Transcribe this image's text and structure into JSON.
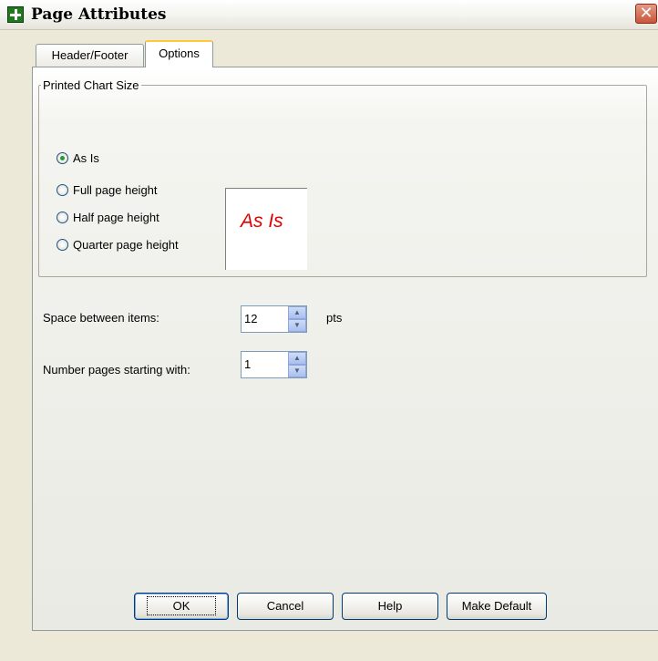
{
  "window": {
    "title": "Page Attributes",
    "close_glyph": "✕"
  },
  "tabs": [
    {
      "label": "Header/Footer",
      "active": false
    },
    {
      "label": "Options",
      "active": true
    }
  ],
  "chart_size": {
    "legend": "Printed Chart Size",
    "options": [
      {
        "label": "As Is",
        "checked": true
      },
      {
        "label": "Full page height",
        "checked": false
      },
      {
        "label": "Half page height",
        "checked": false
      },
      {
        "label": "Quarter page height",
        "checked": false
      }
    ],
    "preview_text": "As Is"
  },
  "space_between": {
    "label": "Space between items:",
    "value": "12",
    "unit": "pts"
  },
  "number_pages": {
    "label": "Number pages starting with:",
    "value": "1"
  },
  "buttons": {
    "ok": "OK",
    "cancel": "Cancel",
    "help": "Help",
    "make_default": "Make Default"
  },
  "colors": {
    "dialog_bg": "#ece9d8",
    "preview_text": "#e00000",
    "button_border": "#003c74"
  }
}
